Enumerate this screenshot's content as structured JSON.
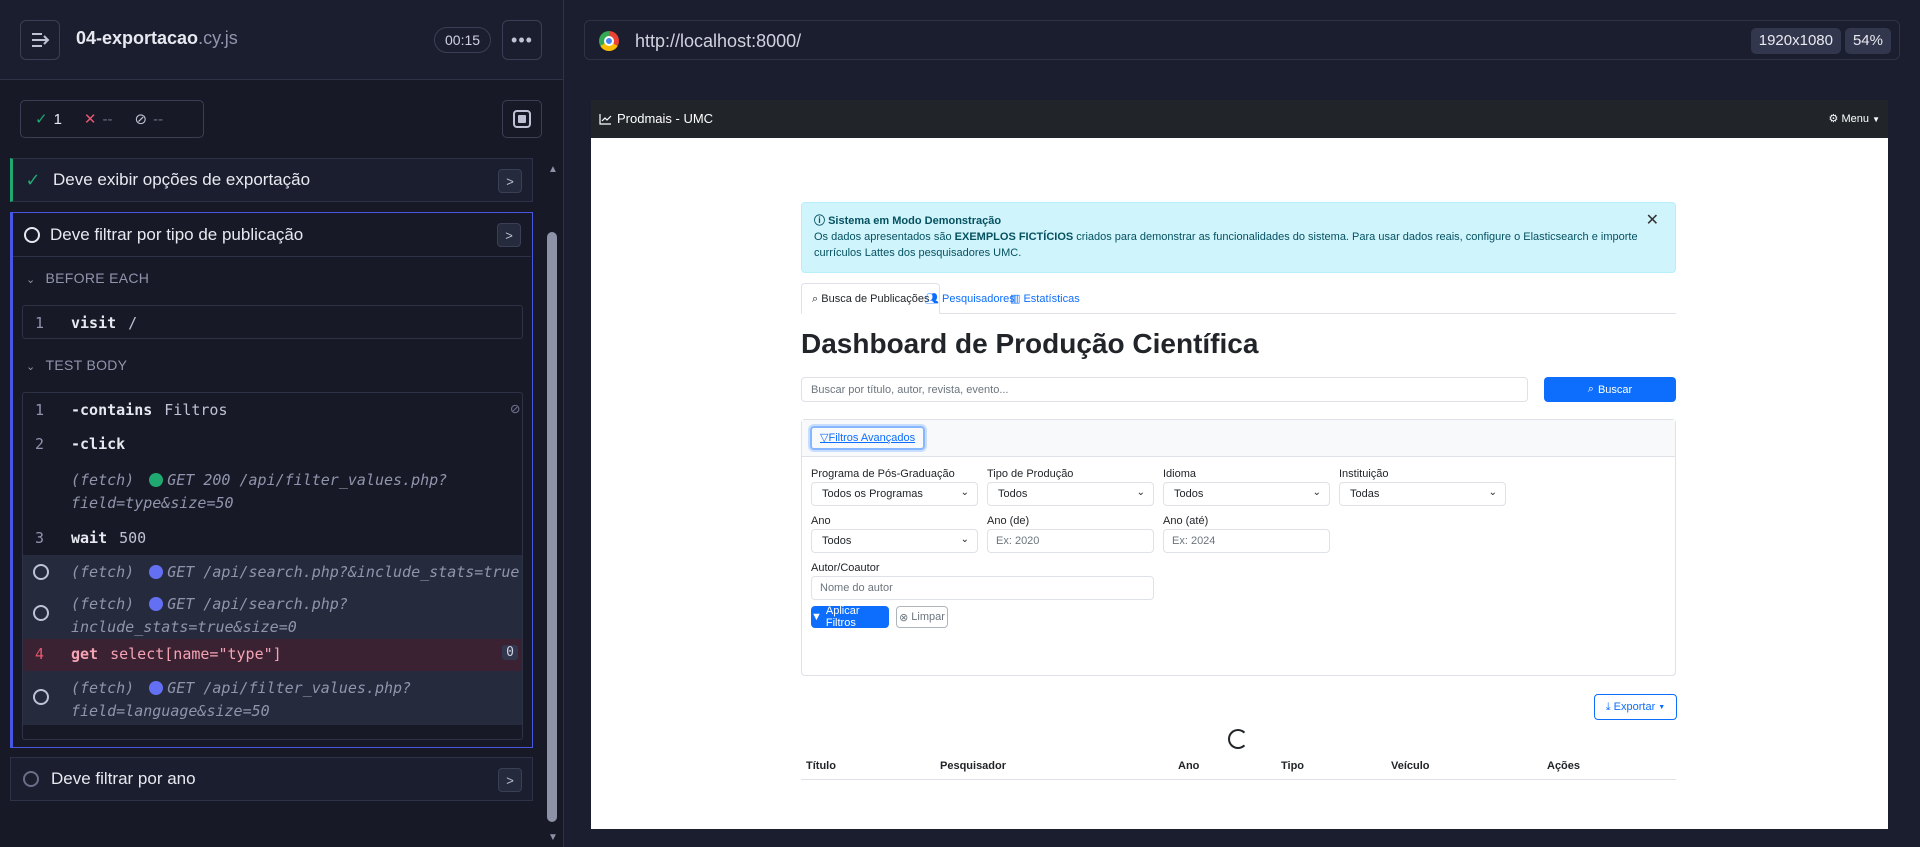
{
  "runner": {
    "spec_name": "04-exportacao",
    "spec_ext": ".cy.js",
    "timer": "00:15",
    "stats": {
      "passed": "1",
      "failed": "--",
      "pending": "--"
    },
    "tests": [
      {
        "title": "Deve exibir opções de exportação",
        "state": "passed"
      },
      {
        "title": "Deve filtrar por tipo de publicação",
        "state": "running"
      },
      {
        "title": "Deve filtrar por ano",
        "state": "pending"
      }
    ],
    "before_each_label": "BEFORE EACH",
    "test_body_label": "TEST BODY",
    "before_each_cmds": [
      {
        "num": "1",
        "name": "visit",
        "arg": "/"
      }
    ],
    "body_cmds": {
      "c1": {
        "num": "1",
        "name": "-contains",
        "arg": "Filtros"
      },
      "c2": {
        "num": "2",
        "name": "-click"
      },
      "f1": {
        "prefix": "(fetch)",
        "text": "GET 200 /api/filter_values.php?",
        "text2": "field=type&size=50"
      },
      "c3": {
        "num": "3",
        "name": "wait",
        "arg": "500"
      },
      "f2": {
        "prefix": "(fetch)",
        "text": "GET /api/search.php?&include_stats=true"
      },
      "f3": {
        "prefix": "(fetch)",
        "text": "GET /api/search.php?",
        "text2": "include_stats=true&size=0"
      },
      "c4": {
        "num": "4",
        "name": "get",
        "arg": "select[name=\"type\"]",
        "badge": "0"
      },
      "f4": {
        "prefix": "(fetch)",
        "text": "GET /api/filter_values.php?",
        "text2": "field=language&size=50"
      }
    }
  },
  "browser": {
    "url": "http://localhost:8000/",
    "resolution": "1920x1080",
    "zoom": "54%"
  },
  "app": {
    "brand": "Prodmais - UMC",
    "menu": "Menu",
    "alert": {
      "title": "Sistema em Modo Demonstração",
      "text_a": "Os dados apresentados são ",
      "text_bold": "EXEMPLOS FICTÍCIOS",
      "text_b": " criados para demonstrar as funcionalidades do sistema. Para usar dados reais, configure o Elasticsearch e importe currículos Lattes dos pesquisadores UMC."
    },
    "tabs": [
      "Busca de Publicações",
      "Pesquisadores",
      "Estatísticas"
    ],
    "page_title": "Dashboard de Produção Científica",
    "search_placeholder": "Buscar por título, autor, revista, evento...",
    "search_button": "Buscar",
    "filters_button": "Filtros Avançados",
    "filters": {
      "programa_label": "Programa de Pós-Graduação",
      "programa_value": "Todos os Programas",
      "tipo_label": "Tipo de Produção",
      "tipo_value": "Todos",
      "idioma_label": "Idioma",
      "idioma_value": "Todos",
      "instituicao_label": "Instituição",
      "instituicao_value": "Todas",
      "ano_label": "Ano",
      "ano_value": "Todos",
      "ano_de_label": "Ano (de)",
      "ano_de_placeholder": "Ex: 2020",
      "ano_ate_label": "Ano (até)",
      "ano_ate_placeholder": "Ex: 2024",
      "autor_label": "Autor/Coautor",
      "autor_placeholder": "Nome do autor"
    },
    "apply_button": "Aplicar Filtros",
    "clear_button": "Limpar",
    "export_button": "Exportar",
    "table_headers": [
      "Título",
      "Pesquisador",
      "Ano",
      "Tipo",
      "Veículo",
      "Ações"
    ]
  },
  "colors": {
    "accent": "#4956e3",
    "pass": "#1fa971",
    "fail": "#e45770",
    "primary": "#0d6efd"
  }
}
